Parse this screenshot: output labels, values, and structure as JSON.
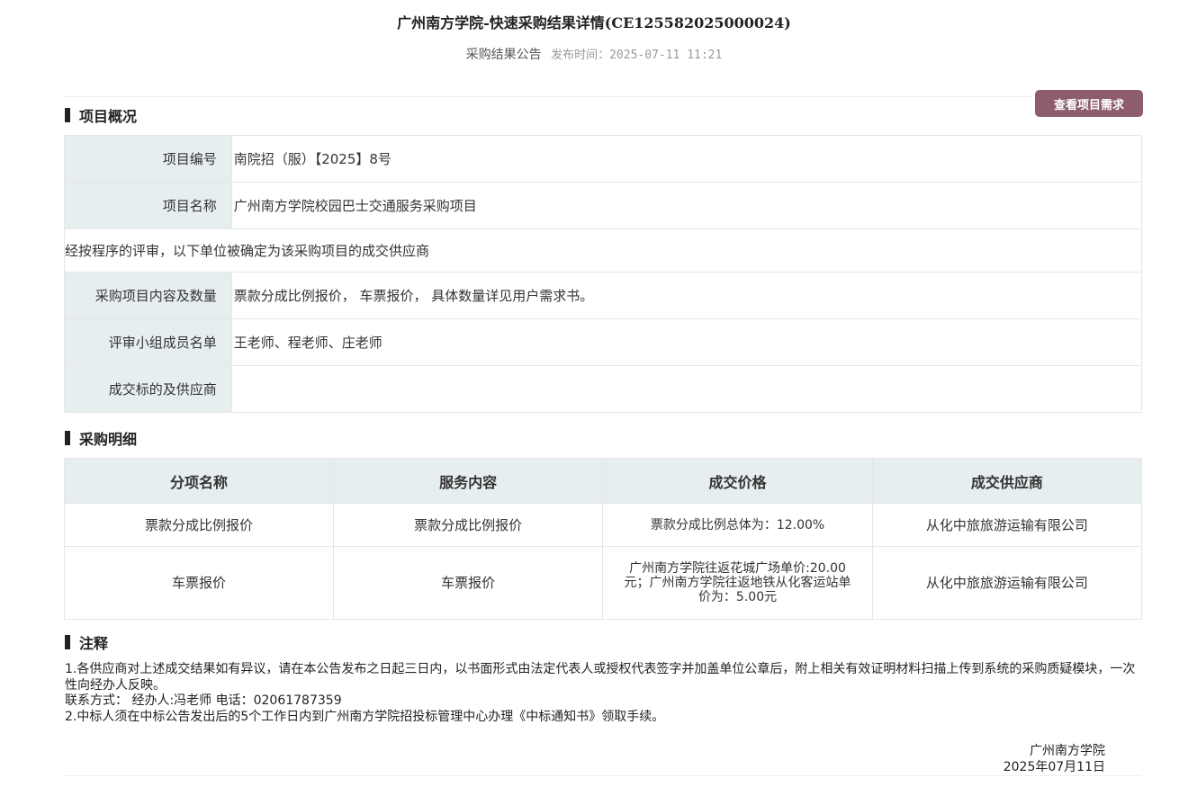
{
  "header": {
    "title": "广州南方学院-快速采购结果详情(CE125582025000024)",
    "subtitle_type": "采购结果公告",
    "subtitle_time": "发布时间：2025-07-11 11:21"
  },
  "actions": {
    "view_requirements": "查看项目需求"
  },
  "overview": {
    "heading": "项目概况",
    "project_no_label": "项目编号",
    "project_no": "南院招（服）【2025】8号",
    "project_name_label": "项目名称",
    "project_name": "广州南方学院校园巴士交通服务采购项目",
    "statement": "经按程序的评审，以下单位被确定为该采购项目的成交供应商",
    "content_label": "采购项目内容及数量",
    "content": "票款分成比例报价， 车票报价， 具体数量详见用户需求书。",
    "panel_label": "评审小组成员名单",
    "panel": "王老师、程老师、庄老师",
    "winner_label": "成交标的及供应商",
    "winner": ""
  },
  "detail": {
    "heading": "采购明细",
    "columns": [
      "分项名称",
      "服务内容",
      "成交价格",
      "成交供应商"
    ],
    "rows": [
      {
        "item": "票款分成比例报价",
        "service": "票款分成比例报价",
        "price": "票款分成比例总体为：12.00%",
        "supplier": "从化中旅旅游运输有限公司"
      },
      {
        "item": "车票报价",
        "service": "车票报价",
        "price": "广州南方学院往返花城广场单价:20.00元；广州南方学院往返地铁从化客运站单价为：5.00元",
        "supplier": "从化中旅旅游运输有限公司"
      }
    ]
  },
  "notes": {
    "heading": "注释",
    "line1": "1.各供应商对上述成交结果如有异议，请在本公告发布之日起三日内，以书面形式由法定代表人或授权代表签字并加盖单位公章后，附上相关有效证明材料扫描上传到系统的采购质疑模块，一次性向经办人反映。",
    "line2": "联系方式：  经办人:冯老师 电话：02061787359",
    "line3": "2.中标人须在中标公告发出后的5个工作日内到广州南方学院招投标管理中心办理《中标通知书》领取手续。"
  },
  "signature": {
    "org": "广州南方学院",
    "date": "2025年07月11日"
  }
}
